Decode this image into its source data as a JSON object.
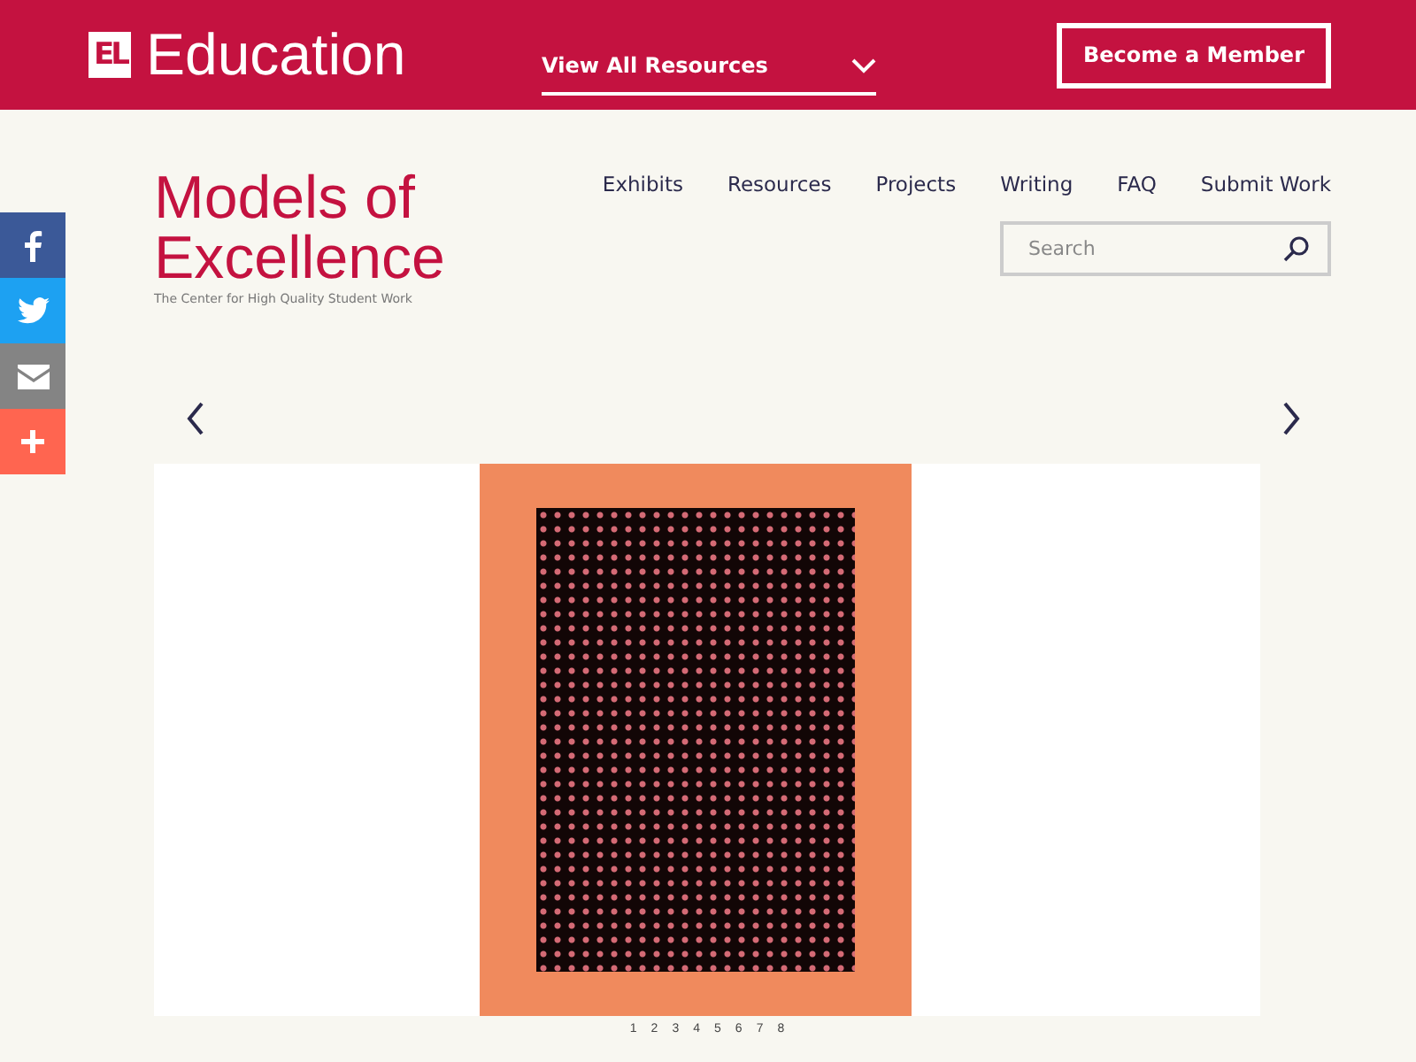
{
  "header": {
    "logo_mark": "EL",
    "logo_text": "Education",
    "resources_dropdown": {
      "label": "View All Resources",
      "expanded": false
    },
    "member_button": "Become a Member"
  },
  "social_bar": [
    {
      "kind": "facebook",
      "color": "#3b5998"
    },
    {
      "kind": "twitter",
      "color": "#1da1f2"
    },
    {
      "kind": "email",
      "color": "#848484"
    },
    {
      "kind": "more",
      "color": "#ff6550"
    }
  ],
  "site": {
    "title_line1": "Models of",
    "title_line2": "Excellence",
    "tagline": "The Center for High Quality Student Work"
  },
  "nav": [
    "Exhibits",
    "Resources",
    "Projects",
    "Writing",
    "FAQ",
    "Submit Work"
  ],
  "search": {
    "placeholder": "Search"
  },
  "pager": [
    "1",
    "2",
    "3",
    "4",
    "5",
    "6",
    "7",
    "8"
  ]
}
